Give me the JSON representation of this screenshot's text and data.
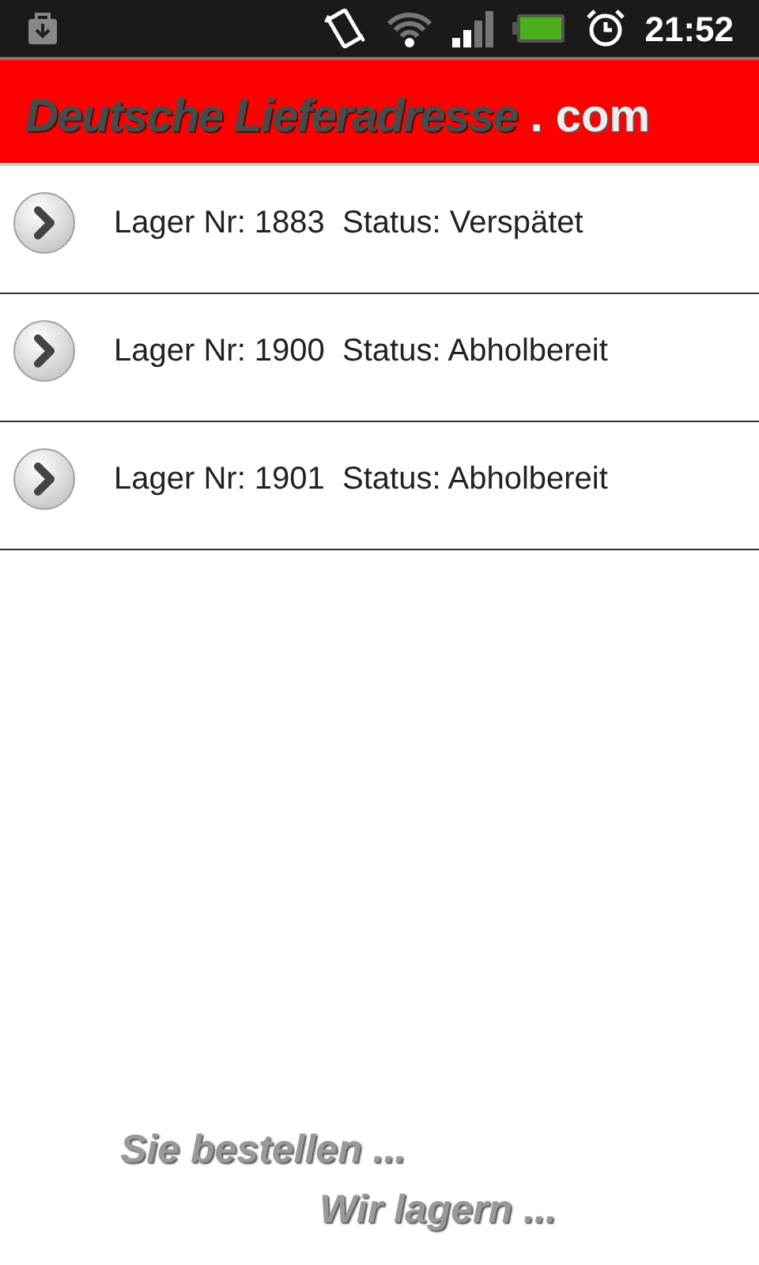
{
  "status_bar": {
    "time": "21:52"
  },
  "header": {
    "logo_name": "Deutsche Lieferadresse",
    "logo_domain": ". com"
  },
  "items": [
    {
      "label": "Lager Nr: 1883  Status: Verspätet"
    },
    {
      "label": "Lager Nr: 1900  Status: Abholbereit"
    },
    {
      "label": "Lager Nr: 1901  Status: Abholbereit"
    }
  ],
  "slogan": {
    "line_1": "Sie bestellen ...",
    "line_2": "Wir lagern ..."
  }
}
